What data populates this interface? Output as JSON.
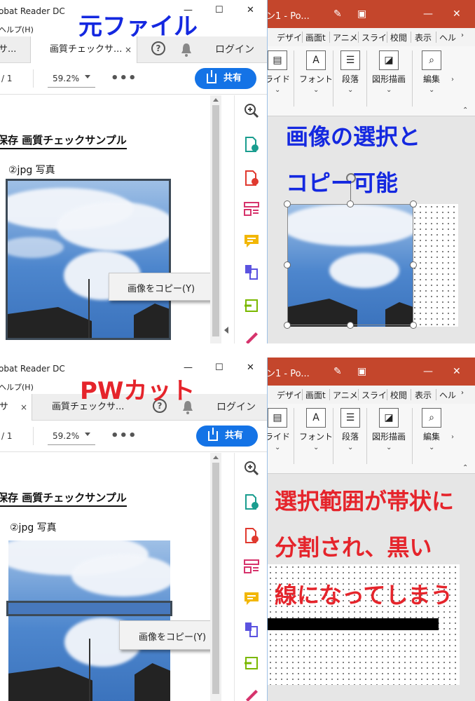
{
  "top": {
    "annotation_title": "元ファイル",
    "acrobat": {
      "title": "obat Reader DC",
      "menu": "ヘルプ(H)",
      "tabs": [
        {
          "label": "サ..."
        },
        {
          "label": "画質チェックサ..."
        }
      ],
      "tab_close": "×",
      "help": "?",
      "login": "ログイン",
      "page_current": "/ 1",
      "zoom": "59.2%",
      "more": "•••",
      "share": "共有",
      "doc_heading": "保存  画質チェックサンプル",
      "doc_sub": "②jpg 写真",
      "context_menu": "画像をコピー(Y)"
    },
    "ppt": {
      "title": "ン1 - Po...",
      "tabs": [
        "デザイ",
        "画面t",
        "アニメ",
        "スライ",
        "校閲",
        "表示",
        "ヘル"
      ],
      "ribbon": [
        "ライド",
        "フォント",
        "段落",
        "図形描画",
        "編集"
      ],
      "annotation_lines": [
        "画像の選択と",
        "コピー可能"
      ]
    }
  },
  "bottom": {
    "annotation_title": "PWカット",
    "acrobat": {
      "title": "obat Reader DC",
      "menu": "ヘルプ(H)",
      "tabs": [
        {
          "label": "サ"
        },
        {
          "label": "画質チェックサ..."
        }
      ],
      "tab_close": "×",
      "help": "?",
      "login": "ログイン",
      "page_current": "/ 1",
      "zoom": "59.2%",
      "more": "•••",
      "share": "共有",
      "doc_heading": "保存  画質チェックサンプル",
      "doc_sub": "②jpg 写真",
      "context_menu": "画像をコピー(Y)"
    },
    "ppt": {
      "title": "ン1 - Po...",
      "tabs": [
        "デザイ",
        "画面t",
        "アニメ",
        "スライ",
        "校閲",
        "表示",
        "ヘル"
      ],
      "ribbon": [
        "ライド",
        "フォント",
        "段落",
        "図形描画",
        "編集"
      ],
      "annotation_lines": [
        "選択範囲が帯状に",
        "分割され、黒い",
        "線になってしまう"
      ]
    }
  },
  "colors": {
    "acrobat_blue": "#1473e6",
    "ppt_red": "#c4462c",
    "annotation_blue": "#1428e0",
    "annotation_red": "#e5242b"
  }
}
